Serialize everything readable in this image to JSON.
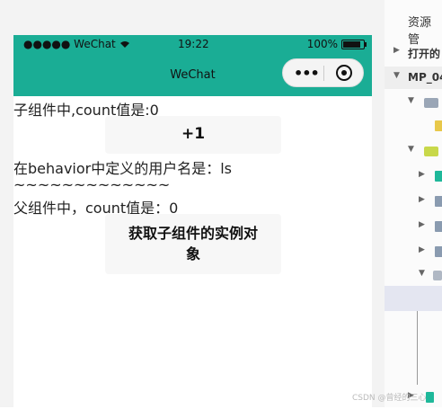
{
  "simulator": {
    "status_bar": {
      "carrier": "●●●●● WeChat",
      "wifi_icon": "wifi-icon",
      "time": "19:22",
      "battery_percent": "100%"
    },
    "nav_bar": {
      "title": "WeChat",
      "menu_icon": "more-dots-icon",
      "close_icon": "target-circle-icon"
    },
    "page": {
      "child_count_text": "子组件中,count值是:0",
      "plus_button_label": "+1",
      "behavior_username_text": "在behavior中定义的用户名是：ls",
      "separator_text": "~~~~~~~~~~~~~",
      "parent_count_text": "父组件中，count值是：0",
      "get_child_button_label": "获取子组件的实例对象"
    }
  },
  "explorer": {
    "title": "资源管",
    "items": [
      {
        "label": "打开的",
        "arrow": "▶"
      },
      {
        "label": "MP_04",
        "arrow": "▼"
      }
    ]
  },
  "colors": {
    "nav_green": "#1aad95",
    "folder_yellow": "#e8c84a",
    "file_teal": "#1fb89a",
    "file_gray": "#8a9bb0",
    "highlight": "#e4e6f1"
  },
  "watermark": "CSDN @曾经的三心"
}
